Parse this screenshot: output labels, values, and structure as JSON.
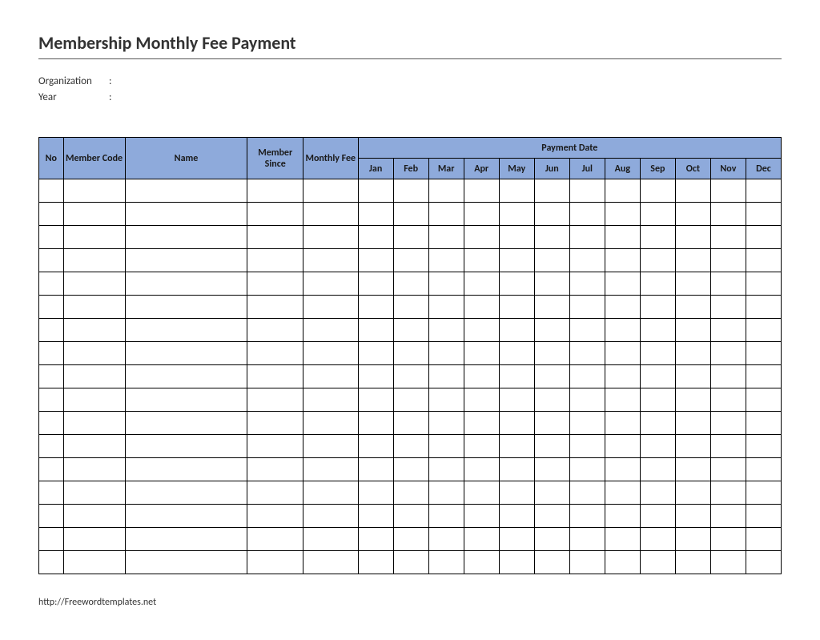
{
  "title": "Membership Monthly Fee Payment",
  "meta": {
    "organization_label": "Organization",
    "year_label": "Year",
    "colon": ":"
  },
  "headers": {
    "no": "No",
    "member_code": "Member Code",
    "name": "Name",
    "member_since": "Member Since",
    "monthly_fee": "Monthly Fee",
    "payment_date": "Payment Date",
    "months": [
      "Jan",
      "Feb",
      "Mar",
      "Apr",
      "May",
      "Jun",
      "Jul",
      "Aug",
      "Sep",
      "Oct",
      "Nov",
      "Dec"
    ]
  },
  "row_count": 17,
  "footer_url": "http://Freewordtemplates.net"
}
